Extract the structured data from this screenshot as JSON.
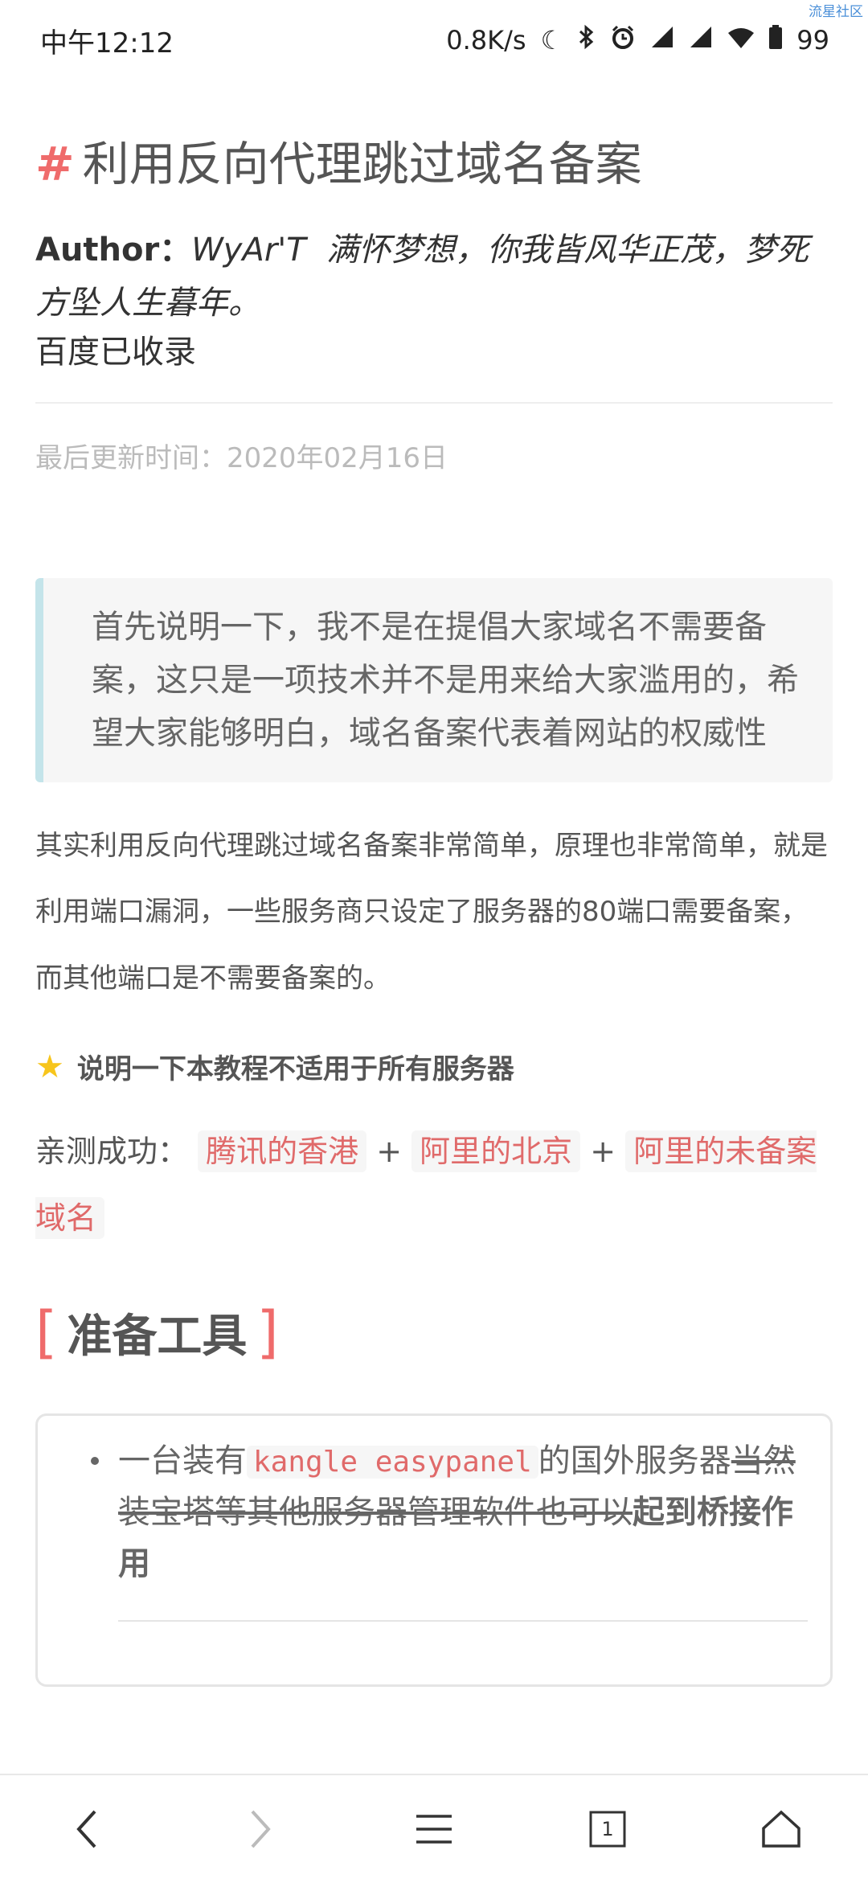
{
  "status_bar": {
    "time": "中午12:12",
    "network_speed": "0.8K/s",
    "battery": "99",
    "watermark": "流星社区"
  },
  "article": {
    "title_hash": "#",
    "title": "利用反向代理跳过域名备案",
    "author_label": "Author：",
    "author_name": "WyAr'T",
    "author_motto": "满怀梦想，你我皆风华正茂，梦死方坠人生暮年。",
    "baidu": "百度已收录",
    "last_updated": "最后更新时间：2020年02月16日",
    "quote": "首先说明一下，我不是在提倡大家域名不需要备案，这只是一项技术并不是用来给大家滥用的，希望大家能够明白，域名备案代表着网站的权威性",
    "paragraph": "其实利用反向代理跳过域名备案非常简单，原理也非常简单，就是利用端口漏洞，一些服务商只设定了服务器的80端口需要备案，而其他端口是不需要备案的。",
    "note": "说明一下本教程不适用于所有服务器",
    "tested_label": "亲测成功：",
    "tested_tags": [
      "腾讯的香港",
      "阿里的北京",
      "阿里的未备案域名"
    ],
    "plus": "+",
    "section_open": "[",
    "section_title": "准备工具",
    "section_close": "]",
    "tool_item": {
      "prefix": "一台装有",
      "code": "kangle easypanel",
      "after_code": "的国外服务器",
      "strike": "当然装宝塔等其他服务器管理软件也可以",
      "bold": "起到桥接作用"
    }
  },
  "nav": {
    "tab_count": "1"
  },
  "colors": {
    "accent_red": "#ef6b6b",
    "tag_red": "#e06a6a",
    "quote_border": "#c4e4ea"
  }
}
